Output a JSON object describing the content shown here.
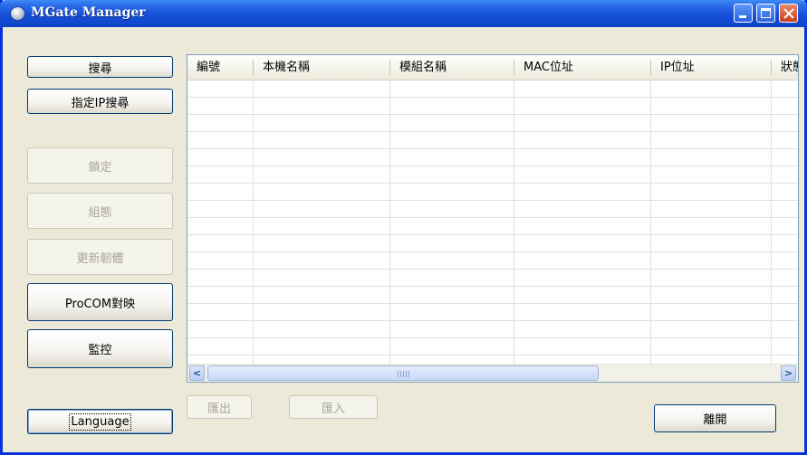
{
  "window": {
    "title": "MGate Manager"
  },
  "sidebar": {
    "search_label": "搜尋",
    "search_ip_label": "指定IP搜尋",
    "lock_label": "鎖定",
    "config_label": "組態",
    "firmware_label": "更新韌體",
    "procom_label": "ProCOM對映",
    "monitor_label": "監控",
    "language_label": "Language"
  },
  "table": {
    "columns": [
      "編號",
      "本機名稱",
      "模組名稱",
      "MAC位址",
      "IP位址",
      "狀態"
    ],
    "rows": []
  },
  "bottom": {
    "export_label": "匯出",
    "import_label": "匯入",
    "exit_label": "離開"
  },
  "colors": {
    "title_bar": "#1650d8",
    "window_bg": "#ece9d8",
    "button_border": "#003c74",
    "disabled_text": "#a8a697"
  }
}
